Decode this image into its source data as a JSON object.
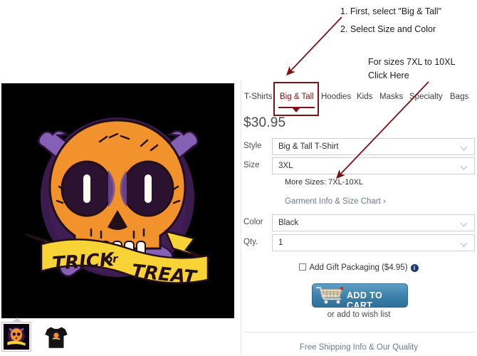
{
  "annotations": {
    "step1": "1. First, select \"Big & Tall\"",
    "step2": "2. Select Size and Color",
    "note_line1": "For sizes 7XL to 10XL",
    "note_line2": "Click Here",
    "color": "#7d1114"
  },
  "product": {
    "price": "$30.95",
    "design_title": "TRICK or TREAT",
    "banner_word1": "TRICK",
    "banner_word2": "or",
    "banner_word3": "TREAT",
    "image_background": "#000000",
    "circle_color": "#3b1b4d",
    "skull_color": "#f2922c",
    "bone_color": "#8560b4",
    "banner_color": "#f7d336"
  },
  "tabs": [
    {
      "label": "T-Shirts",
      "active": false
    },
    {
      "label": "Big & Tall",
      "active": true
    },
    {
      "label": "Hoodies",
      "active": false
    },
    {
      "label": "Kids",
      "active": false
    },
    {
      "label": "Masks",
      "active": false
    },
    {
      "label": "Specialty",
      "active": false
    },
    {
      "label": "Bags",
      "active": false
    }
  ],
  "form": {
    "style": {
      "label": "Style",
      "value": "Big & Tall T-Shirt"
    },
    "size": {
      "label": "Size",
      "value": "3XL"
    },
    "color": {
      "label": "Color",
      "value": "Black"
    },
    "qty": {
      "label": "Qty.",
      "value": "1"
    },
    "more_sizes": "More Sizes: 7XL-10XL",
    "garment_link": "Garment Info & Size Chart ›"
  },
  "purchase": {
    "gift_label": "Add Gift Packaging ($4.95)",
    "add_to_cart": "ADD TO CART",
    "wish_list": "or add to wish list",
    "footer_link": "Free Shipping Info & Our Quality"
  },
  "thumbnails": [
    {
      "name": "design-thumbnail",
      "selected": true
    },
    {
      "name": "shirt-thumbnail",
      "selected": false
    }
  ]
}
